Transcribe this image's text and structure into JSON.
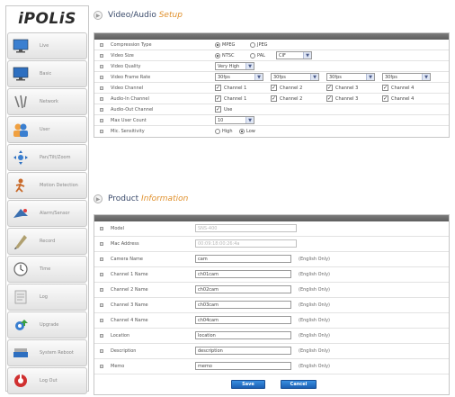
{
  "logo": "iPOLiS",
  "sidebar": {
    "items": [
      {
        "label": "Live",
        "icon": "monitor-icon"
      },
      {
        "label": "Basic",
        "icon": "monitor-icon"
      },
      {
        "label": "Network",
        "icon": "network-icon"
      },
      {
        "label": "User",
        "icon": "users-icon"
      },
      {
        "label": "Pan/Tilt/Zoom",
        "icon": "ptz-icon"
      },
      {
        "label": "Motion Detection",
        "icon": "motion-icon"
      },
      {
        "label": "Alarm/Sensor",
        "icon": "alarm-icon"
      },
      {
        "label": "Record",
        "icon": "record-icon"
      },
      {
        "label": "Time",
        "icon": "clock-icon"
      },
      {
        "label": "Log",
        "icon": "log-icon"
      },
      {
        "label": "Upgrade",
        "icon": "upgrade-icon"
      },
      {
        "label": "System Reboot",
        "icon": "reboot-icon"
      },
      {
        "label": "Log Out",
        "icon": "logout-icon"
      }
    ]
  },
  "video_section": {
    "title_part1": "Video/Audio",
    "title_part2": "Setup",
    "compression": {
      "label": "Compression Type",
      "opt1": "MPEG",
      "opt2": "JPEG"
    },
    "video_size": {
      "label": "Video Size",
      "opt1": "NTSC",
      "opt2": "PAL",
      "select": "CIF"
    },
    "video_quality": {
      "label": "Video Quality",
      "select": "Very High"
    },
    "frame_rate": {
      "label": "Video Frame Rate",
      "values": [
        "30fps",
        "30fps",
        "30fps",
        "30fps"
      ]
    },
    "video_channel": {
      "label": "Video Channel",
      "channels": [
        "Channel 1",
        "Channel 2",
        "Channel 3",
        "Channel 4"
      ]
    },
    "audio_in": {
      "label": "Audio-In Channel",
      "channels": [
        "Channel 1",
        "Channel 2",
        "Channel 3",
        "Channel 4"
      ]
    },
    "audio_out": {
      "label": "Audio-Out Channel",
      "option": "Use"
    },
    "max_user": {
      "label": "Max User Count",
      "select": "10"
    },
    "mic": {
      "label": "Mic. Sensitivity",
      "opt1": "High",
      "opt2": "Low"
    }
  },
  "product_section": {
    "title_part1": "Product",
    "title_part2": "Information",
    "model": {
      "label": "Model",
      "value": "SNS-400"
    },
    "mac": {
      "label": "Mac Address",
      "value": "00:09:18:00:26:4a"
    },
    "camera_name": {
      "label": "Camera Name",
      "value": "cam"
    },
    "ch1": {
      "label": "Channel 1 Name",
      "value": "ch01cam"
    },
    "ch2": {
      "label": "Channel 2 Name",
      "value": "ch02cam"
    },
    "ch3": {
      "label": "Channel 3 Name",
      "value": "ch03cam"
    },
    "ch4": {
      "label": "Channel 4 Name",
      "value": "ch04cam"
    },
    "location": {
      "label": "Location",
      "value": "location"
    },
    "description": {
      "label": "Description",
      "value": "description"
    },
    "memo": {
      "label": "Memo",
      "value": "memo"
    },
    "hint": "(English Only)"
  },
  "buttons": {
    "save": "Save",
    "cancel": "Cancel"
  },
  "colors": {
    "accent_orange": "#e0902c",
    "button_blue": "#2a74cc",
    "panel_header": "#6b6b6b"
  }
}
